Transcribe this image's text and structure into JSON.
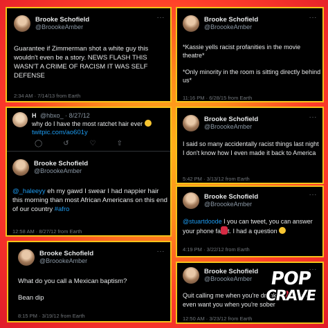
{
  "cards": {
    "c1": {
      "name": "Brooke Schofield",
      "handle": "@BroookeAmber",
      "text": "Guarantee if Zimmerman shot a white guy  this wouldn't even be a story. NEWS FLASH THIS WASN'T A CRIME OF RACISM IT WAS SELF DEFENSE",
      "meta": "2:34 AM · 7/14/13 from Earth"
    },
    "c2": {
      "name": "Brooke Schofield",
      "handle": "@BroookeAmber",
      "text1": "*Kassie yells racist profanities in the movie theatre*",
      "text2": "*Only minority in the room is sitting directly behind us*",
      "meta": "11:16 PM · 6/28/15 from Earth"
    },
    "c3": {
      "reply_name": "H",
      "reply_handle": "@hbxo_ · 8/27/12",
      "reply_text": "why do I have the most ratchet hair ever",
      "reply_link": "twitpic.com/ao601y",
      "name": "Brooke Schofield",
      "handle": "@BroookeAmber",
      "mention": "@_haleeyy",
      "text": " eh my gawd I swear I had nappier hair this morning than most African Americans on this end of our country ",
      "hashtag": "#afro",
      "meta": "12:58 AM · 8/27/12 from Earth"
    },
    "c4": {
      "name": "Brooke Schofield",
      "handle": "@BroookeAmber",
      "text": "I said so many accidentally racist things last night I don't know how I even made it back to America",
      "meta": "5:42 PM · 3/13/12 from Earth"
    },
    "c5": {
      "name": "Brooke Schofield",
      "handle": "@BroookeAmber",
      "mention": "@stuartdoode",
      "text_a": " I you can tweet, you can answer your phone fa",
      "text_b": "t. I had a question ",
      "meta": "4:19 PM · 3/22/12 from Earth"
    },
    "c6": {
      "name": "Brooke Schofield",
      "handle": "@BroookeAmber",
      "text1": "What do you call a Mexican baptism?",
      "text2": "Bean dip",
      "meta": "8:15 PM · 3/19/12 from Earth"
    },
    "c7": {
      "name": "Brooke Schofield",
      "handle": "@BroookeAmber",
      "text_a": "Quit calling me when you're drunk, f",
      "text_b": "t. I don't even want you when you're sober",
      "meta": "12:50 AM · 3/23/12 from Earth"
    }
  },
  "logo": {
    "line1": "POP",
    "line2": "CRAVE"
  },
  "dots": "···",
  "colors": {
    "accent": "#f4c21a",
    "link": "#1d9bf0",
    "background": "#ff5a22"
  }
}
